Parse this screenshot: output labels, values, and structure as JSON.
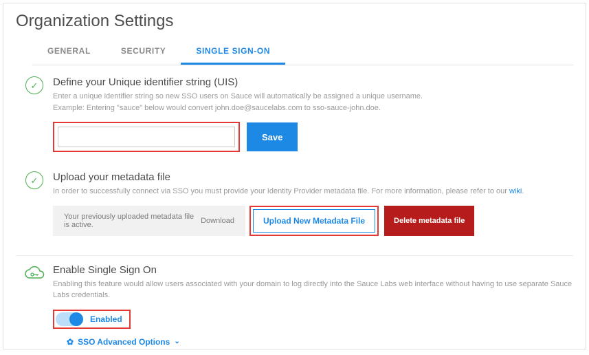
{
  "page": {
    "title": "Organization Settings"
  },
  "tabs": {
    "general": "GENERAL",
    "security": "SECURITY",
    "sso": "SINGLE SIGN-ON"
  },
  "uis": {
    "title": "Define your Unique identifier string (UIS)",
    "help_line1": "Enter a unique identifier string so new SSO users on Sauce will automatically be assigned a unique username.",
    "help_line2": "Example: Entering \"sauce\" below would convert john.doe@saucelabs.com to sso-sauce-john.doe.",
    "input_value": "",
    "save_label": "Save"
  },
  "metadata": {
    "title": "Upload your metadata file",
    "help_prefix": "In order to successfully connect via SSO you must provide your Identity Provider metadata file. For more information, please refer to our ",
    "wiki_label": "wiki",
    "help_suffix": ".",
    "active_text": "Your previously uploaded metadata file is active. ",
    "download_label": "Download",
    "upload_label": "Upload New Metadata File",
    "delete_label": "Delete metadata file"
  },
  "enable": {
    "title": "Enable Single Sign On",
    "help": "Enabling this feature would allow users associated with your domain to log directly into the Sauce Labs web interface without having to use separate Sauce Labs credentials.",
    "toggle_label": "Enabled",
    "advanced_label": "SSO Advanced Options"
  },
  "icons": {
    "check": "✓",
    "gear": "✿",
    "chevron_down": "⌄"
  },
  "colors": {
    "primary": "#1e88e5",
    "success": "#4caf50",
    "danger": "#b71c1c",
    "highlight": "#e53935"
  }
}
